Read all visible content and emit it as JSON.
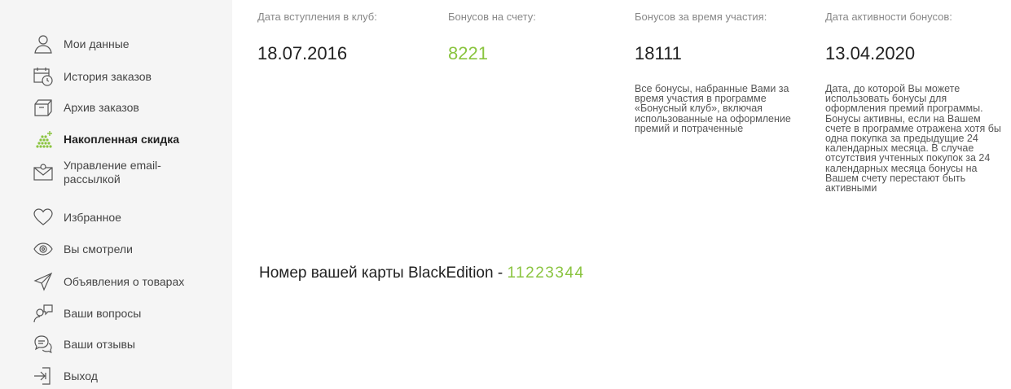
{
  "sidebar": {
    "items": [
      {
        "label": "Мои данные",
        "icon": "user-icon"
      },
      {
        "label": "История заказов",
        "icon": "order-history-icon"
      },
      {
        "label": "Архив заказов",
        "icon": "archive-icon"
      },
      {
        "label": "Накопленная скидка",
        "icon": "discount-coins-icon",
        "active": true
      },
      {
        "label": "Управление email-рассылкой",
        "icon": "email-icon"
      },
      {
        "label": "Избранное",
        "icon": "heart-icon"
      },
      {
        "label": "Вы смотрели",
        "icon": "eye-icon"
      },
      {
        "label": "Объявления о товарах",
        "icon": "paper-plane-icon"
      },
      {
        "label": "Ваши вопросы",
        "icon": "question-icon"
      },
      {
        "label": "Ваши отзывы",
        "icon": "reviews-icon"
      },
      {
        "label": "Выход",
        "icon": "logout-icon"
      }
    ]
  },
  "stats": {
    "join_date": {
      "label": "Дата вступления в клуб:",
      "value": "18.07.2016"
    },
    "balance": {
      "label": "Бонусов на счету:",
      "value": "8221"
    },
    "total": {
      "label": "Бонусов за время участия:",
      "value": "18111",
      "description": "Все бонусы, набранные Вами за время участия в программе «Бонусный клуб», включая использованные на оформление премий и потраченные"
    },
    "active_date": {
      "label": "Дата активности бонусов:",
      "value": "13.04.2020",
      "description": "Дата, до которой Вы можете использовать бонусы для оформления премий программы. Бонусы активны, если на Вашем счете в программе отражена хотя бы одна покупка за предыдущие 24 календарных месяца. В случае отсутствия учтенных покупок за 24 календарных месяца бонусы на Вашем счету перестают быть активными"
    }
  },
  "card": {
    "prefix": "Номер вашей карты BlackEdition - ",
    "number": "11223344"
  },
  "colors": {
    "accent": "#8ac43f",
    "sidebar_bg": "#f5f5f5"
  }
}
